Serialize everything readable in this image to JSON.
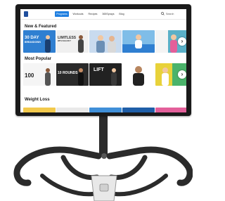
{
  "nav": {
    "logo": "",
    "items": [
      {
        "label": "Programs",
        "active": true
      },
      {
        "label": "Workouts",
        "active": false
      },
      {
        "label": "Recipes",
        "active": false
      },
      {
        "label": "365Sprays",
        "active": false
      },
      {
        "label": "Blog",
        "active": false
      }
    ],
    "search_label": "Search",
    "icon": "search-icon"
  },
  "sections": [
    {
      "title": "New & Featured",
      "tiles": [
        {
          "text": "30 DAY",
          "sub": "BREAKDOWN",
          "color": "#2f7fd1",
          "text_color": "#ffffff"
        },
        {
          "text": "LIMITLESS",
          "sub": "WITH SHAUN T",
          "badge": "",
          "color": "#f0f0f0",
          "text_color": "#333333"
        },
        {
          "text": "",
          "sub": "",
          "color": "#e8e4e0",
          "text_color": "#333333"
        },
        {
          "text": "",
          "sub": "",
          "color": "#3f8fd8",
          "text_color": "#ffffff"
        },
        {
          "text": "",
          "sub": "",
          "color": "#4aa3b8",
          "text_color": "#ffffff"
        }
      ]
    },
    {
      "title": "Most Popular",
      "tiles": [
        {
          "text": "100",
          "sub": "",
          "badge": "",
          "color": "#f5f5f5",
          "text_color": "#222222"
        },
        {
          "text": "10 ROUNDS",
          "sub": "",
          "color": "#2a2a2a",
          "text_color": "#ffffff"
        },
        {
          "text": "LIFT",
          "sub": "",
          "color": "#222222",
          "text_color": "#ffffff"
        },
        {
          "text": "",
          "sub": "",
          "color": "#ffffff",
          "text_color": "#222222"
        },
        {
          "text": "",
          "sub": "",
          "color": "#e8d23a",
          "text_color": "#222222"
        }
      ]
    },
    {
      "title": "Weight Loss",
      "tiles": [
        {
          "color": "#f2c94c"
        },
        {
          "color": "#e9e9e9"
        },
        {
          "color": "#3f8fd8"
        },
        {
          "color": "#1f5ea8"
        },
        {
          "color": "#e35f9a"
        }
      ]
    }
  ],
  "next_label": "›",
  "colors": {
    "frame": "#1a1a1a",
    "accent": "#1f7fe0",
    "bike": "#2b2b2b"
  }
}
